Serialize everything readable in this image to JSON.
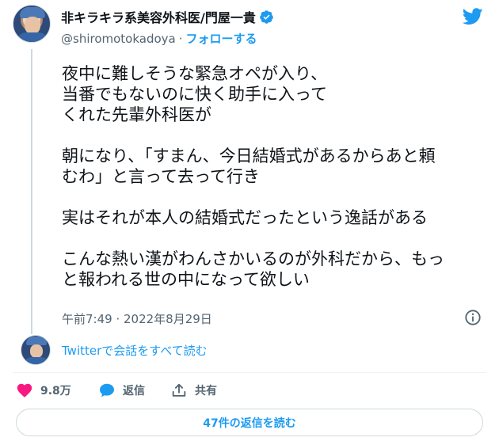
{
  "author": {
    "name": "非キラキラ系美容外科医/門屋一貴",
    "handle": "@shiromotokadoya",
    "separator": "·",
    "follow_label": "フォローする",
    "verified": true
  },
  "tweet": {
    "text": "夜中に難しそうな緊急オペが入り、\n当番でもないのに快く助手に入って\nくれた先輩外科医が\n\n朝になり、「すまん、今日結婚式があるからあと頼\nむわ」と言って去って行き\n\n実はそれが本人の結婚式だったという逸話がある\n\nこんな熱い漢がわんさかいるのが外科だから、もっ\nと報われる世の中になって欲しい",
    "timestamp": "午前7:49 · 2022年8月29日"
  },
  "thread": {
    "read_label": "Twitterで会話をすべて読む"
  },
  "actions": {
    "likes_count": "9.8万",
    "reply_label": "返信",
    "share_label": "共有"
  },
  "replies_button": {
    "label": "47件の返信を読む"
  },
  "colors": {
    "accent": "#1d9bf0",
    "like": "#f91880",
    "muted": "#536471",
    "text": "#0f1419"
  },
  "icons": [
    "verified-badge-icon",
    "twitter-bird-icon",
    "info-icon",
    "heart-icon",
    "reply-bubble-icon",
    "share-icon"
  ]
}
